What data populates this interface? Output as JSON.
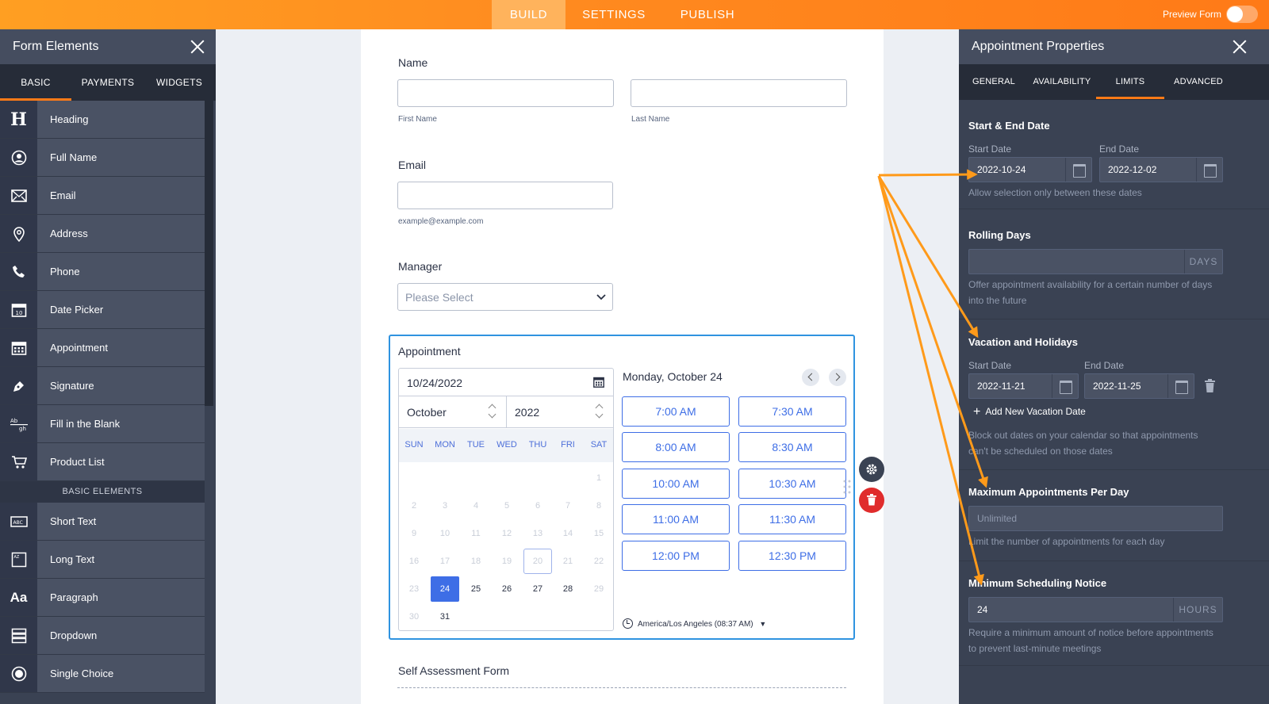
{
  "topbar": {
    "tabs": [
      "BUILD",
      "SETTINGS",
      "PUBLISH"
    ],
    "preview_label": "Preview Form"
  },
  "left": {
    "title": "Form Elements",
    "tabs": [
      "BASIC",
      "PAYMENTS",
      "WIDGETS"
    ],
    "items": [
      {
        "label": "Heading",
        "icon": "heading-icon"
      },
      {
        "label": "Full Name",
        "icon": "user-icon"
      },
      {
        "label": "Email",
        "icon": "envelope-icon"
      },
      {
        "label": "Address",
        "icon": "location-icon"
      },
      {
        "label": "Phone",
        "icon": "phone-icon"
      },
      {
        "label": "Date Picker",
        "icon": "calendar-icon"
      },
      {
        "label": "Appointment",
        "icon": "appointment-icon"
      },
      {
        "label": "Signature",
        "icon": "pen-icon"
      },
      {
        "label": "Fill in the Blank",
        "icon": "fill-blank-icon"
      },
      {
        "label": "Product List",
        "icon": "cart-icon"
      }
    ],
    "section_header": "BASIC ELEMENTS",
    "basic_items": [
      {
        "label": "Short Text",
        "icon": "short-text-icon"
      },
      {
        "label": "Long Text",
        "icon": "long-text-icon"
      },
      {
        "label": "Paragraph",
        "icon": "paragraph-icon"
      },
      {
        "label": "Dropdown",
        "icon": "dropdown-icon"
      },
      {
        "label": "Single Choice",
        "icon": "radio-icon"
      }
    ]
  },
  "form": {
    "name_label": "Name",
    "first_name_sub": "First Name",
    "last_name_sub": "Last Name",
    "email_label": "Email",
    "email_sub": "example@example.com",
    "manager_label": "Manager",
    "manager_placeholder": "Please Select",
    "appointment": {
      "label": "Appointment",
      "date_value": "10/24/2022",
      "month": "October",
      "year": "2022",
      "weekdays": [
        "SUN",
        "MON",
        "TUE",
        "WED",
        "THU",
        "FRI",
        "SAT"
      ],
      "days": [
        "1",
        "2",
        "3",
        "4",
        "5",
        "6",
        "7",
        "8",
        "9",
        "10",
        "11",
        "12",
        "13",
        "14",
        "15",
        "16",
        "17",
        "18",
        "19",
        "20",
        "21",
        "22",
        "23",
        "24",
        "25",
        "26",
        "27",
        "28",
        "29",
        "30",
        "31"
      ],
      "selected_day": "24",
      "today_day": "20",
      "slot_title": "Monday, October 24",
      "slots": [
        "7:00 AM",
        "7:30 AM",
        "8:00 AM",
        "8:30 AM",
        "10:00 AM",
        "10:30 AM",
        "11:00 AM",
        "11:30 AM",
        "12:00 PM",
        "12:30 PM"
      ],
      "timezone": "America/Los Angeles (08:37 AM)"
    },
    "next_label": "Self Assessment Form"
  },
  "right": {
    "title": "Appointment Properties",
    "tabs": [
      "GENERAL",
      "AVAILABILITY",
      "LIMITS",
      "ADVANCED"
    ],
    "start_end": {
      "title": "Start & End Date",
      "start_label": "Start Date",
      "start_value": "2022-10-24",
      "end_label": "End Date",
      "end_value": "2022-12-02",
      "help": "Allow selection only between these dates"
    },
    "rolling": {
      "title": "Rolling Days",
      "suffix": "DAYS",
      "help_1": "Offer appointment availability for a certain number of days",
      "help_2": "into the future"
    },
    "vacation": {
      "title": "Vacation and Holidays",
      "start_label": "Start Date",
      "start_value": "2022-11-21",
      "end_label": "End Date",
      "end_value": "2022-11-25",
      "add_label": "Add New Vacation Date",
      "help_1": "Block out dates on your calendar so that appointments",
      "help_2": "can't be scheduled on those dates"
    },
    "max_per_day": {
      "title": "Maximum Appointments Per Day",
      "placeholder": "Unlimited",
      "help": "Limit the number of appointments for each day"
    },
    "min_notice": {
      "title": "Minimum Scheduling Notice",
      "value": "24",
      "suffix": "HOURS",
      "help_1": "Require a minimum amount of notice before appointments",
      "help_2": "to prevent last-minute meetings"
    }
  },
  "colors": {
    "accent_orange": "#ff7a17",
    "arrow_orange": "#ff9a1a",
    "primary_blue": "#3e6ee6",
    "panel_dark": "#3a4253"
  }
}
